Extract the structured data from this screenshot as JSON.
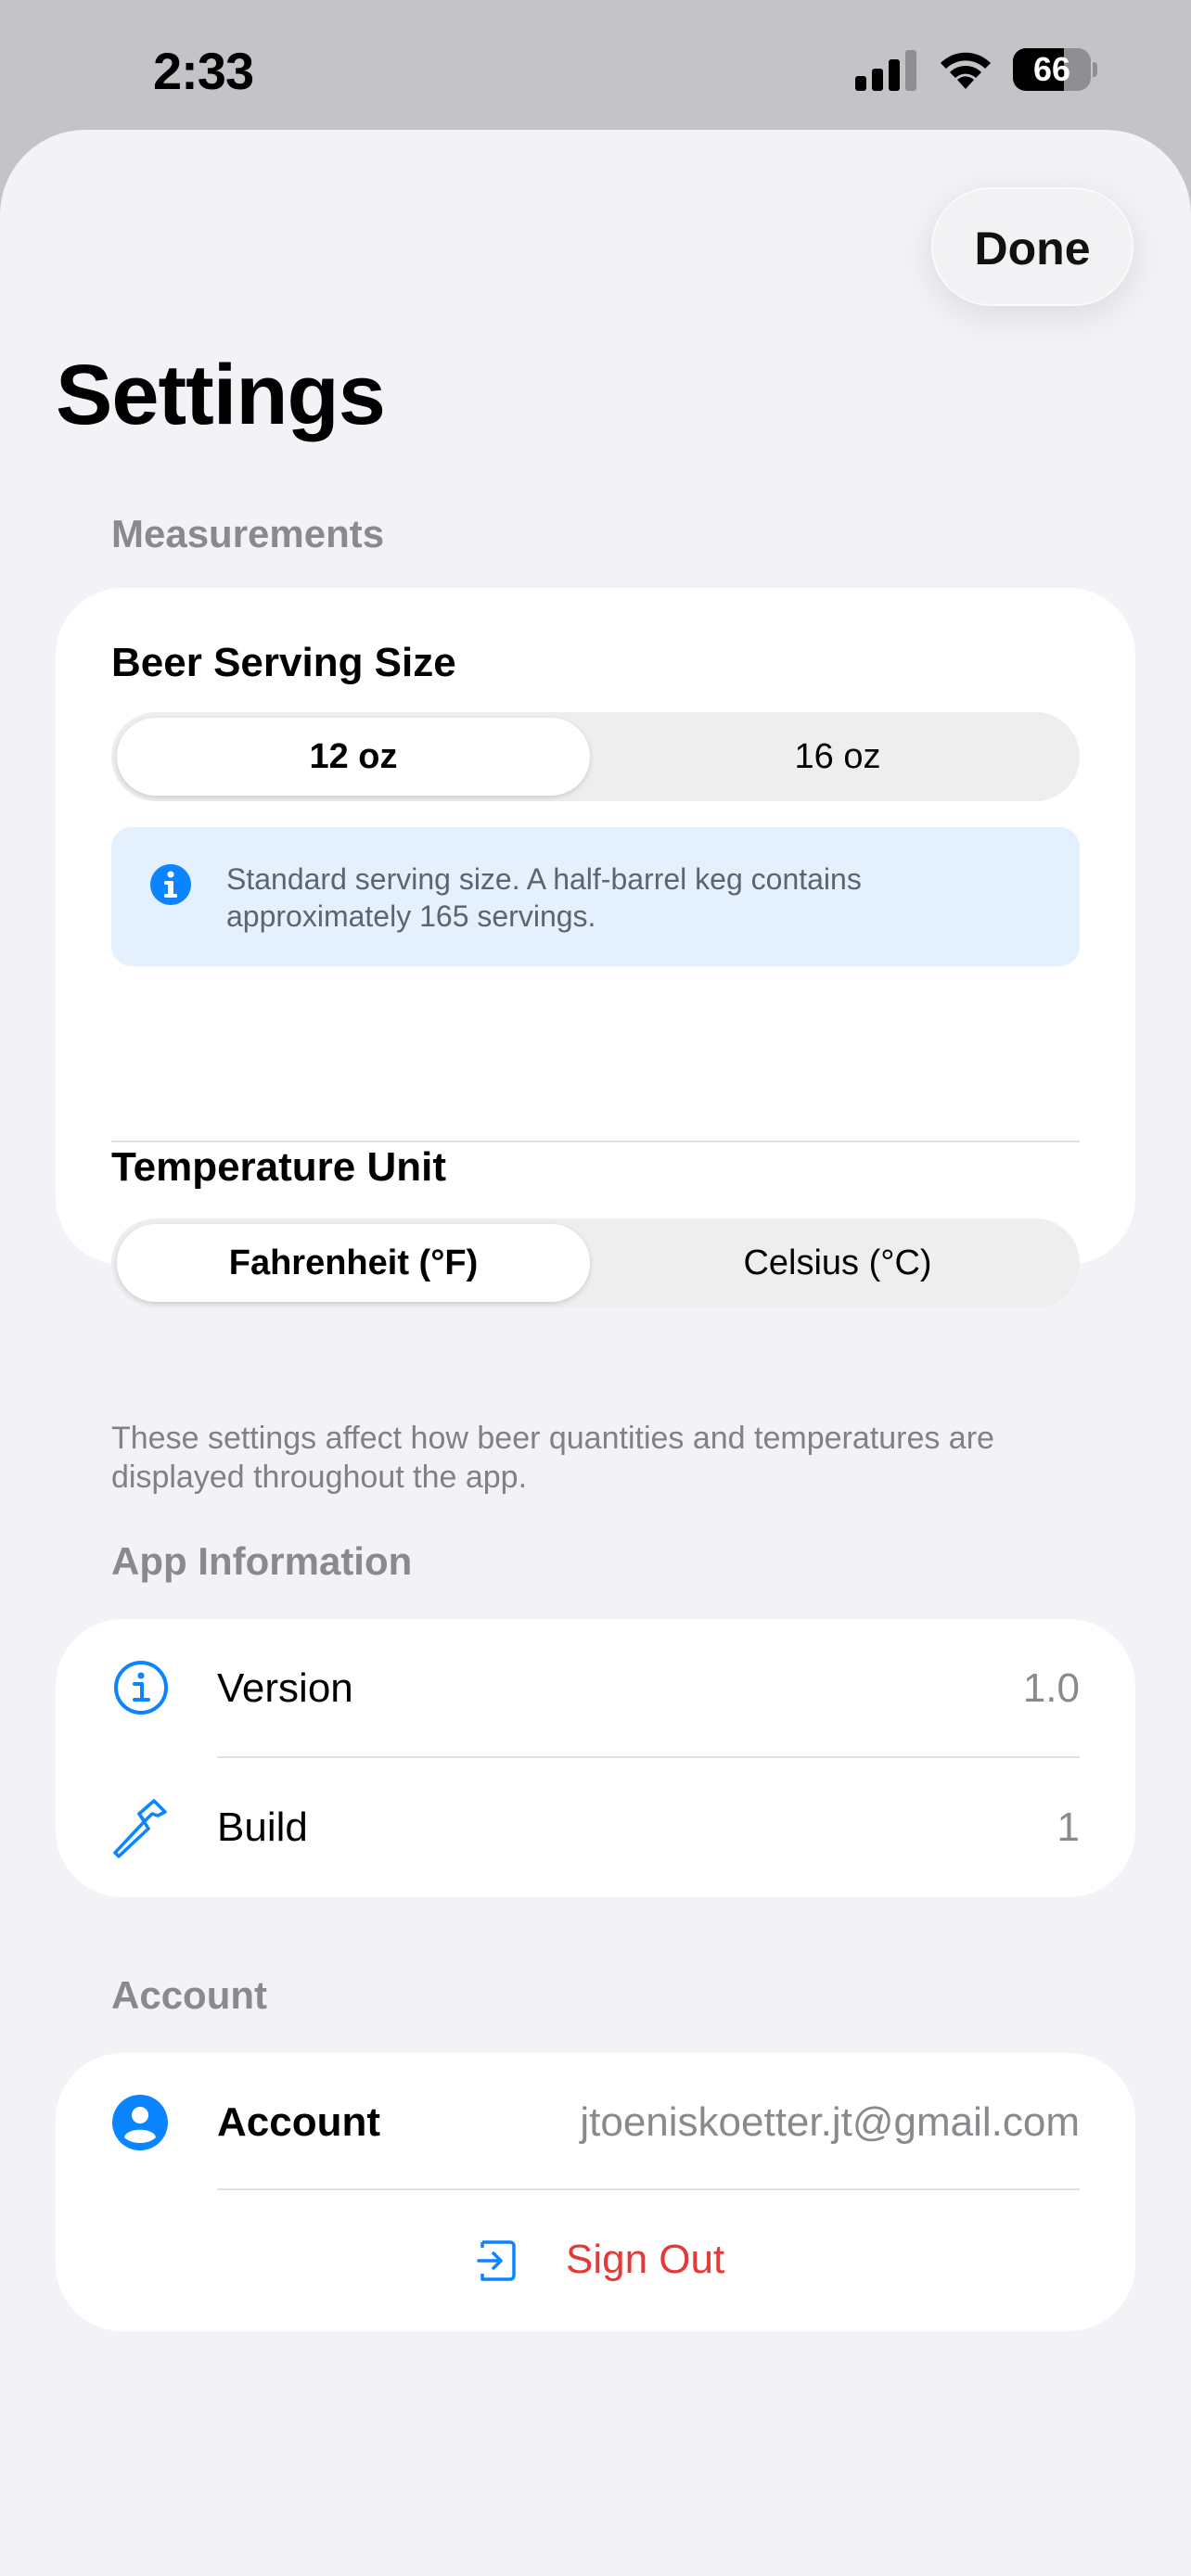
{
  "status_bar": {
    "time": "2:33",
    "battery_level": "66",
    "battery_fraction": 0.66
  },
  "header": {
    "done_label": "Done",
    "title": "Settings"
  },
  "measurements": {
    "section_title": "Measurements",
    "beer_serving": {
      "label": "Beer Serving Size",
      "options": [
        "12 oz",
        "16 oz"
      ],
      "selected": "12 oz",
      "info_text": "Standard serving size. A half-barrel keg contains approximately 165 servings."
    },
    "temperature": {
      "label": "Temperature Unit",
      "options": [
        "Fahrenheit (°F)",
        "Celsius (°C)"
      ],
      "selected": "Fahrenheit (°F)"
    },
    "footer_note": "These settings affect how beer quantities and temperatures are displayed throughout the app."
  },
  "app_info": {
    "section_title": "App Information",
    "rows": [
      {
        "label": "Version",
        "value": "1.0",
        "icon": "info-circle-icon"
      },
      {
        "label": "Build",
        "value": "1",
        "icon": "hammer-icon"
      }
    ]
  },
  "account": {
    "section_title": "Account",
    "label": "Account",
    "email": "jtoeniskoetter.jt@gmail.com",
    "sign_out_label": "Sign Out",
    "icon": "person-circle-icon"
  },
  "colors": {
    "accent": "#0a84ff",
    "destructive": "#e53935",
    "background": "#f2f2f7"
  }
}
